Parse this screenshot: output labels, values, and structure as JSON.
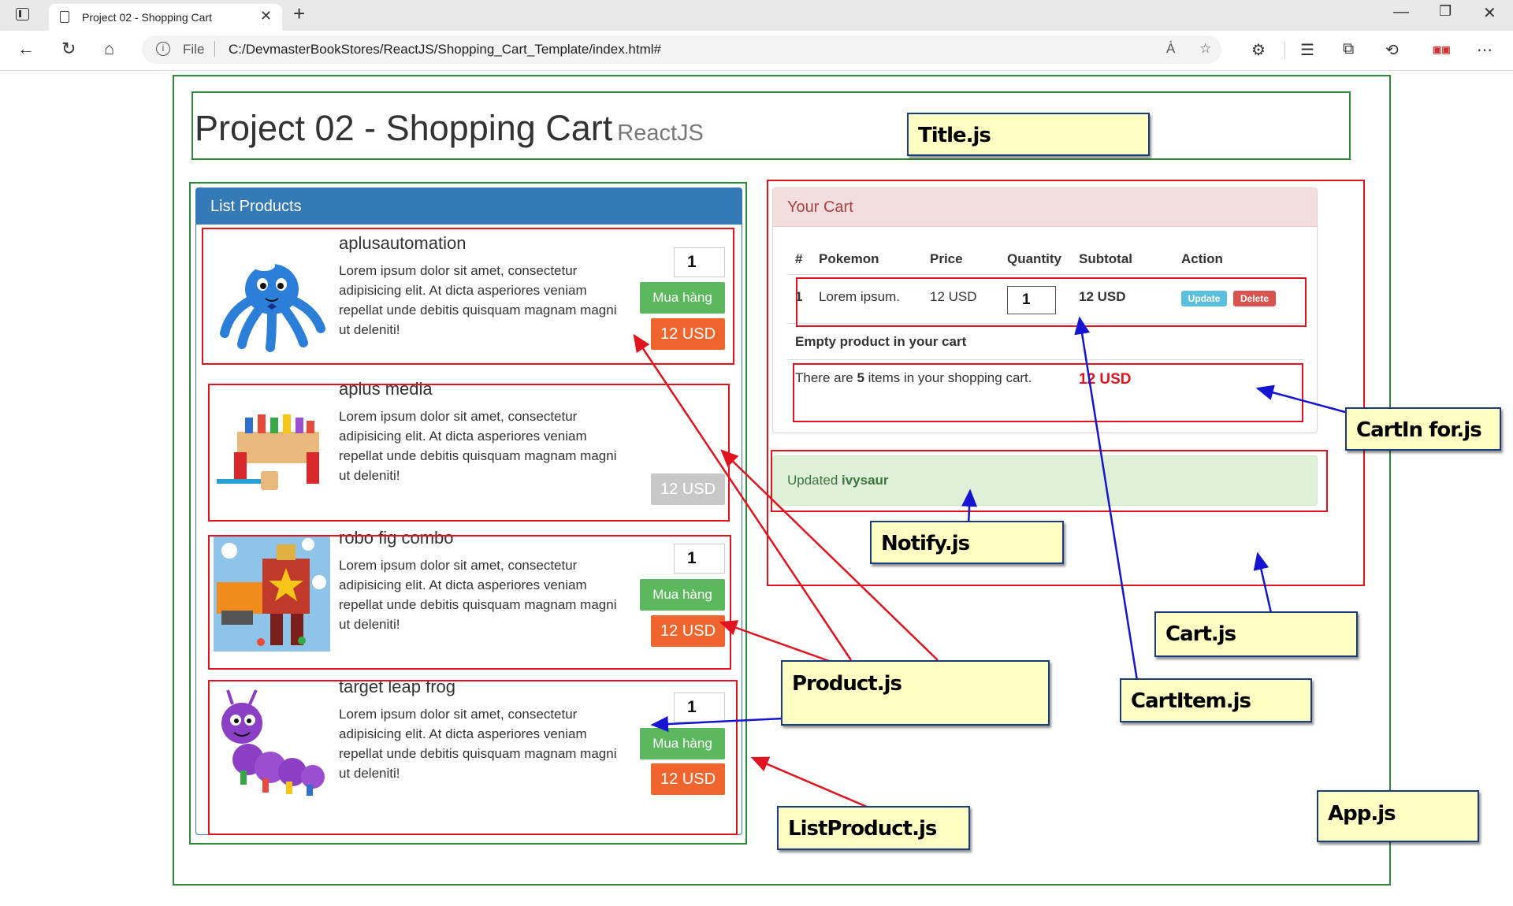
{
  "browser": {
    "tab_title": "Project 02 - Shopping Cart",
    "address_scheme": "File",
    "address_url": "C:/DevmasterBookStores/ReactJS/Shopping_Cart_Template/index.html#"
  },
  "page": {
    "title": "Project 02 - Shopping Cart",
    "subtitle": "ReactJS"
  },
  "list_products": {
    "heading": "List Products",
    "items": [
      {
        "name": "aplusautomation",
        "description": "Lorem ipsum dolor sit amet, consectetur adipisicing elit. At dicta asperiores veniam repellat unde debitis quisquam magnam magni ut deleniti!",
        "quantity": "1",
        "buy_label": "Mua hàng",
        "price": "12 USD",
        "image": "blue-octopus-toy"
      },
      {
        "name": "aplus media",
        "description": "Lorem ipsum dolor sit amet, consectetur adipisicing elit. At dicta asperiores veniam repellat unde debitis quisquam magnam magni ut deleniti!",
        "price": "12 USD",
        "image": "pound-bench-toy"
      },
      {
        "name": "robo fig combo",
        "description": "Lorem ipsum dolor sit amet, consectetur adipisicing elit. At dicta asperiores veniam repellat unde debitis quisquam magnam magni ut deleniti!",
        "quantity": "1",
        "buy_label": "Mua hàng",
        "price": "12 USD",
        "image": "robot-toy"
      },
      {
        "name": "target leap frog",
        "description": "Lorem ipsum dolor sit amet, consectetur adipisicing elit. At dicta asperiores veniam repellat unde debitis quisquam magnam magni ut deleniti!",
        "quantity": "1",
        "buy_label": "Mua hàng",
        "price": "12 USD",
        "image": "caterpillar-toy"
      }
    ]
  },
  "cart": {
    "heading": "Your Cart",
    "columns": [
      "#",
      "Pokemon",
      "Price",
      "Quantity",
      "Subtotal",
      "Action"
    ],
    "row": {
      "index": "1",
      "name": "Lorem ipsum.",
      "price": "12 USD",
      "quantity": "1",
      "subtotal": "12 USD",
      "update_label": "Update",
      "delete_label": "Delete"
    },
    "empty_message": "Empty product in your cart",
    "info_prefix": "There are ",
    "info_count": "5",
    "info_suffix": " items in your shopping cart.",
    "total": "12 USD"
  },
  "notify": {
    "prefix": "Updated ",
    "item": "ivysaur"
  },
  "annotations": {
    "title": "Title.js",
    "cart_info": "CartIn for.js",
    "notify": "Notify.js",
    "cart": "Cart.js",
    "product": "Product.js",
    "cart_item": "CartItem.js",
    "list_product": "ListProduct.js",
    "app": "App.js"
  },
  "colors": {
    "app_border": "#2e8b3a",
    "component_border": "#e0141e",
    "note_bg": "#ffffc4",
    "arrow_red": "#e0141e",
    "arrow_blue": "#1414d2",
    "primary": "#337ab7",
    "buy_green": "#5cb85c",
    "price_orange": "#f0652e"
  }
}
